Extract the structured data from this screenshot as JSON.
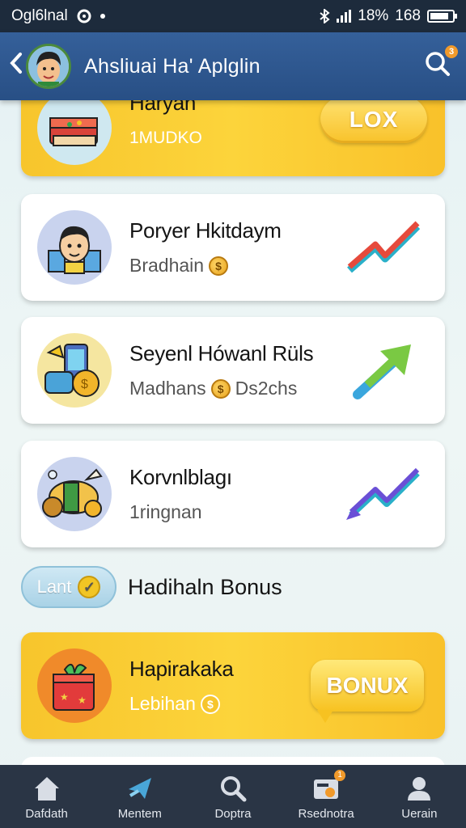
{
  "status_bar": {
    "carrier": "Ogl6lnal",
    "battery": "18%",
    "time": "168"
  },
  "header": {
    "title": "Ahsliuai Ha' Aplglin"
  },
  "cards": [
    {
      "title": "Haryan",
      "subtitle": "1MUDKO",
      "button_label": "LOX"
    },
    {
      "title": "Poryer Hkitdaym",
      "subtitle": "Bradhain",
      "trend_color": "#e64a3c"
    },
    {
      "title": "Seyenl Hówanl Rüls",
      "subtitle": "Madhans",
      "subtitle2": "Ds2chs",
      "trend_color": "#7ac943"
    },
    {
      "title": "Korvnlblagı",
      "subtitle": "1ringnan",
      "trend_color": "#6a4fd6"
    }
  ],
  "section": {
    "pill_label": "Lant",
    "title": "Hadihaln Bonus"
  },
  "bonus_card": {
    "title": "Hapirakaka",
    "subtitle": "Lebihan",
    "button_label": "BONUX"
  },
  "bottom_nav": [
    {
      "label": "Dafdath",
      "icon": "home-icon"
    },
    {
      "label": "Mentem",
      "icon": "send-icon"
    },
    {
      "label": "Doptra",
      "icon": "search-icon"
    },
    {
      "label": "Rsednotra",
      "icon": "inbox-icon"
    },
    {
      "label": "Uerain",
      "icon": "user-icon"
    }
  ],
  "colors": {
    "header": "#2f5a92",
    "status_bar": "#1d2b3c",
    "gold": "#f9c82c",
    "nav": "#2a3545"
  }
}
